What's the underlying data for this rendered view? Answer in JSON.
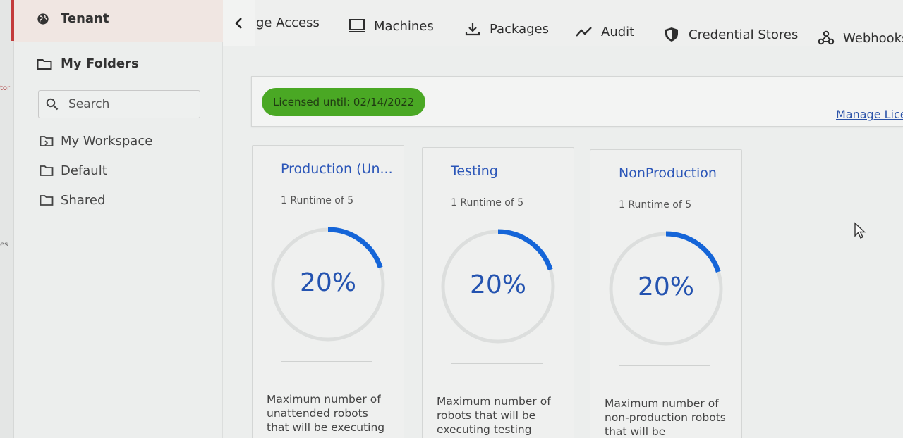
{
  "edge": {
    "text_top": "tor",
    "text_mid": "es"
  },
  "sidebar": {
    "tenant_label": "Tenant",
    "my_folders_label": "My Folders",
    "search_placeholder": "Search",
    "items": [
      {
        "label": "My Workspace",
        "icon": "workspace-folder-icon"
      },
      {
        "label": "Default",
        "icon": "folder-icon"
      },
      {
        "label": "Shared",
        "icon": "folder-icon"
      }
    ]
  },
  "topnav": {
    "items": [
      {
        "label": "ge Access",
        "icon": ""
      },
      {
        "label": "Machines",
        "icon": "monitor-icon"
      },
      {
        "label": "Packages",
        "icon": "download-icon"
      },
      {
        "label": "Audit",
        "icon": "activity-icon"
      },
      {
        "label": "Credential Stores",
        "icon": "shield-icon"
      },
      {
        "label": "Webhooks",
        "icon": "webhook-icon"
      }
    ]
  },
  "license": {
    "badge_text": "Licensed until: 02/14/2022",
    "badge_color": "#4aa824",
    "manage_link": "Manage Lice"
  },
  "cards": [
    {
      "title": "Production (Un...",
      "subtitle": "1 Runtime of 5",
      "percent_label": "20%",
      "percent": 20,
      "description": "Maximum number of unattended robots that will be executing"
    },
    {
      "title": "Testing",
      "subtitle": "1 Runtime of 5",
      "percent_label": "20%",
      "percent": 20,
      "description": "Maximum number of robots that will be executing testing"
    },
    {
      "title": "NonProduction",
      "subtitle": "1 Runtime of 5",
      "percent_label": "20%",
      "percent": 20,
      "description": "Maximum number of non-production robots that will be"
    }
  ],
  "colors": {
    "accent": "#1565d8",
    "title_blue": "#2b56b8",
    "ring_track": "#dcdedd"
  }
}
